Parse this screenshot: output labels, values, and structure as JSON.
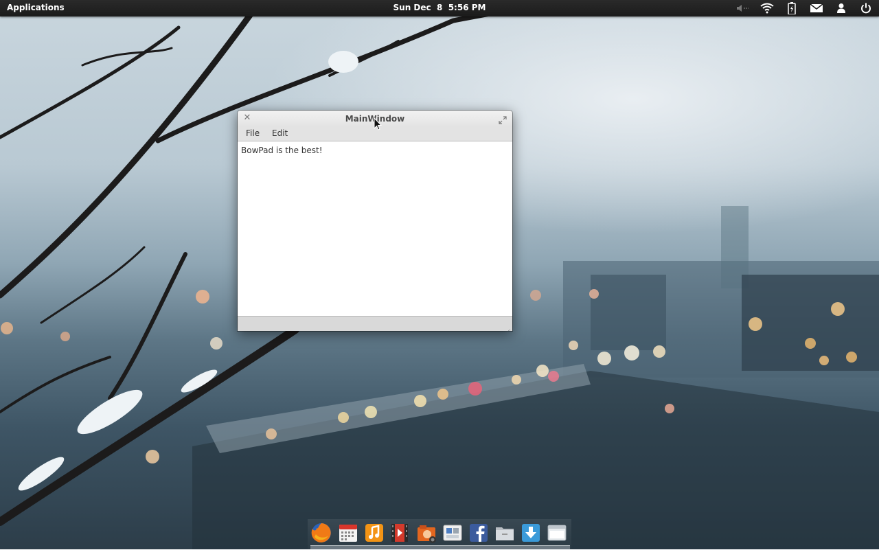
{
  "panel": {
    "applications_label": "Applications",
    "clock": "Sun Dec  8  5:56 PM",
    "indicators": [
      "volume-muted-icon",
      "wifi-icon",
      "battery-icon",
      "mail-icon",
      "user-icon",
      "power-icon"
    ]
  },
  "window": {
    "title": "MainWindow",
    "menu": {
      "file": "File",
      "edit": "Edit"
    },
    "editor_text": "BowPad is the best!"
  },
  "dock": {
    "items": [
      "firefox-icon",
      "calendar-icon",
      "music-icon",
      "video-icon",
      "photos-icon",
      "settings-icon",
      "facebook-icon",
      "files-icon",
      "downloads-icon",
      "window-icon"
    ]
  },
  "colors": {
    "panel_bg": "#1b1b1b",
    "titlebar": "#e8e8e8",
    "editor_bg": "#ffffff"
  }
}
